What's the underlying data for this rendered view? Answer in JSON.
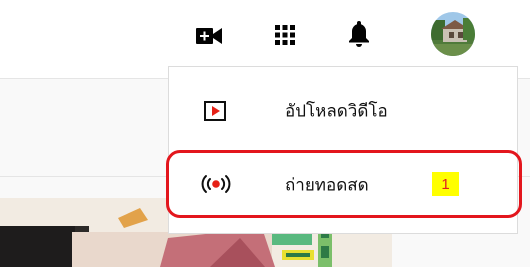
{
  "header": {
    "create_icon": "video-camera-plus-icon",
    "apps_icon": "apps-grid-icon",
    "notifications_icon": "bell-icon",
    "avatar": "account-avatar"
  },
  "create_menu": {
    "items": [
      {
        "label": "อัปโหลดวิดีโอ",
        "icon": "upload-video-icon"
      },
      {
        "label": "ถ่ายทอดสด",
        "icon": "go-live-icon"
      }
    ]
  },
  "annotation": {
    "badge_text": "1",
    "color": "#e3161d"
  }
}
